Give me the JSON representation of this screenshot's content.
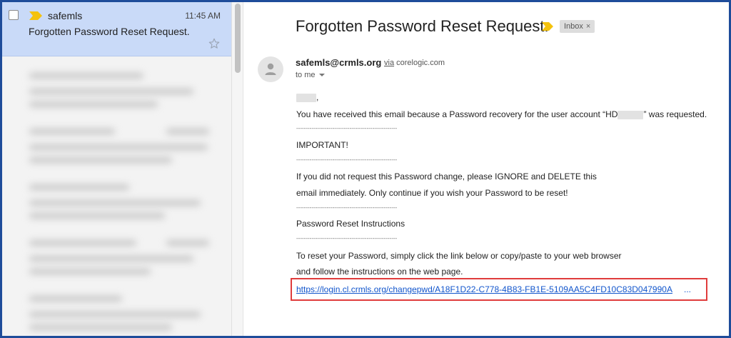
{
  "message_list": {
    "selected": {
      "sender": "safemls",
      "time": "11:45 AM",
      "subject": "Forgotten Password Reset Request."
    }
  },
  "message": {
    "title": "Forgotten Password Reset Request.",
    "label_chip": "Inbox",
    "label_chip_close": "×",
    "from_email": "safemls@crmls.org",
    "via_word": "via",
    "via_domain": "corelogic.com",
    "to_me": "to me",
    "body": {
      "greeting_suffix": ",",
      "line1_pre": "You have received this email because a Password recovery for the user account “HD",
      "line1_post": "” was requested.",
      "dashes": "-----------------------------------------------------",
      "important": "IMPORTANT!",
      "ignore_line1": "If you did not request this Password change, please IGNORE and DELETE this",
      "ignore_line2": "email immediately. Only continue if you wish your Password to be reset!",
      "instructions_heading": "Password Reset Instructions",
      "reset_line1": "To reset your Password, simply click the link below or copy/paste to your web browser",
      "reset_line2": "and follow the instructions on the web page.",
      "link": "https://login.cl.crmls.org/changepwd/A18F1D22-C778-4B83-FB1E-5109AA5C4FD10C83D047990A",
      "link_ellipsis": "..."
    }
  },
  "colors": {
    "frame": "#1e4c9a",
    "selected_row": "#c9daf8",
    "importance_marker": "#f4c20d",
    "link": "#1155cc",
    "highlight_box": "#e03c3c"
  },
  "icons": {
    "importance": "importance-marker-icon",
    "star": "star-icon",
    "avatar": "person-icon",
    "dropdown": "caret-down-icon"
  }
}
